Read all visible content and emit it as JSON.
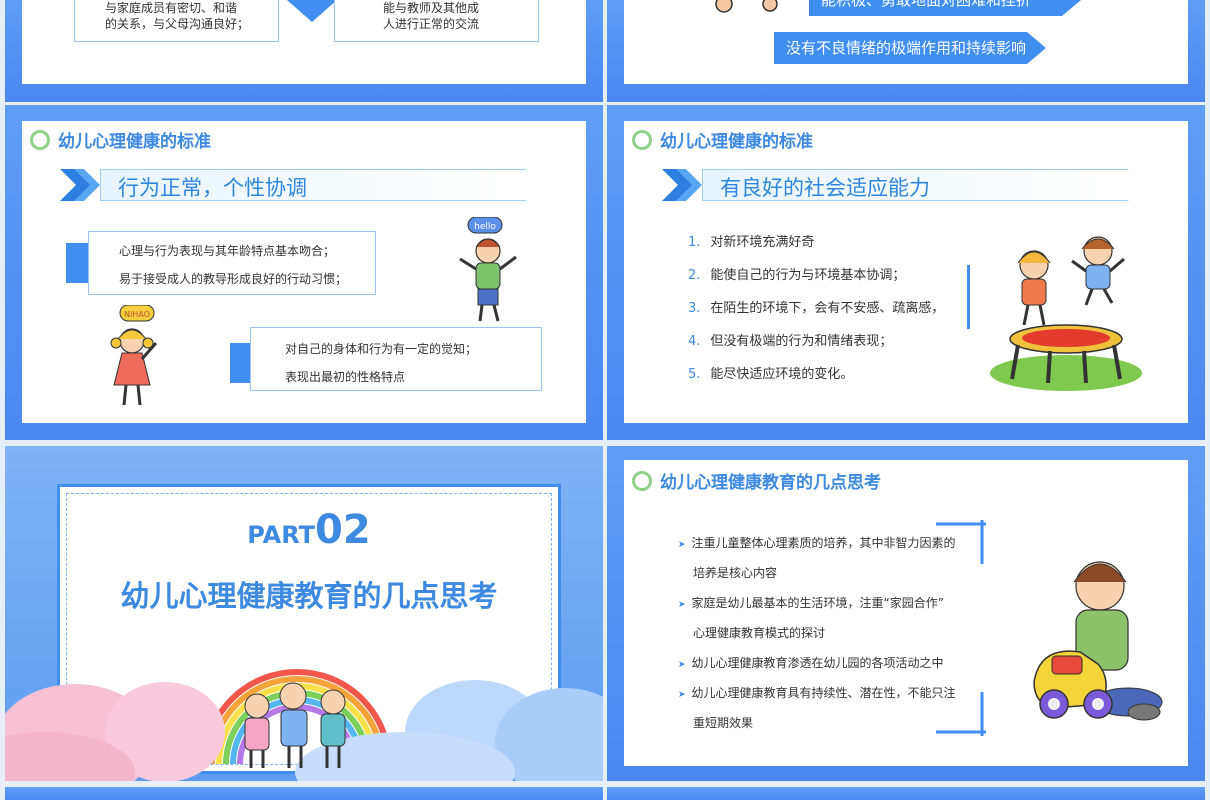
{
  "slide1": {
    "box_left_lines": [
      "与家庭成员有密切、和谐",
      "的关系，与父母沟通良好；"
    ],
    "box_right_lines": [
      "能与教师及其他成",
      "人进行正常的交流"
    ]
  },
  "slide2": {
    "tag_top": "能积极、勇敢地面对困难和挫折",
    "tag_bottom": "没有不良情绪的极端作用和持续影响"
  },
  "slide3": {
    "heading": "幼儿心理健康的标准",
    "banner": "行为正常，个性协调",
    "box1_lines": [
      "心理与行为表现与其年龄特点基本吻合；",
      "易于接受成人的教导形成良好的行动习惯；"
    ],
    "box2_lines": [
      "对自己的身体和行为有一定的觉知；",
      "表现出最初的性格特点"
    ],
    "bubble_boy": "hello",
    "bubble_girl": "NIHAO"
  },
  "slide4": {
    "heading": "幼儿心理健康的标准",
    "banner": "有良好的社会适应能力",
    "items": [
      {
        "n": "1.",
        "text": "对新环境充满好奇"
      },
      {
        "n": "2.",
        "text": "能使自己的行为与环境基本协调；"
      },
      {
        "n": "3.",
        "text": "在陌生的环境下，会有不安感、疏离感，"
      },
      {
        "n": "4.",
        "text": "但没有极端的行为和情绪表现；"
      },
      {
        "n": "5.",
        "text": "能尽快适应环境的变化。"
      }
    ]
  },
  "slide5": {
    "part_word": "PART",
    "part_num": "02",
    "title": "幼儿心理健康教育的几点思考"
  },
  "slide6": {
    "heading": "幼儿心理健康教育的几点思考",
    "bullets": [
      "注重儿童整体心理素质的培养，其中非智力因素的",
      "培养是核心内容",
      "家庭是幼儿最基本的生活环境，注重“家园合作”",
      "心理健康教育模式的探讨",
      "幼儿心理健康教育渗透在幼儿园的各项活动之中",
      "幼儿心理健康教育具有持续性、潜在性，不能只注",
      "重短期效果"
    ],
    "bullet_flags": [
      true,
      false,
      true,
      false,
      true,
      true,
      false
    ]
  },
  "colors": {
    "accent": "#3d8ae0",
    "slide_bg": "#4a88f0",
    "ring": "#8fd18a"
  }
}
